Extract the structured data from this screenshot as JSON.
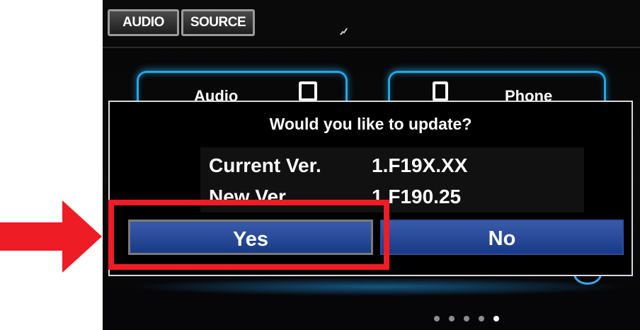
{
  "header": {
    "tabs": [
      {
        "label": "AUDIO"
      },
      {
        "label": "SOURCE"
      }
    ]
  },
  "menu": {
    "tiles": [
      {
        "label": "Audio",
        "icon": "audio-device-icon"
      },
      {
        "label": "Phone",
        "icon": "phone-icon"
      }
    ]
  },
  "dialog": {
    "title": "Would you like to update?",
    "current_label": "Current Ver.",
    "current_value": "1.F19X.XX",
    "new_label": "New Ver.",
    "new_value": "1.F190.25",
    "yes_label": "Yes",
    "no_label": "No"
  },
  "pager": {
    "pages": 5,
    "active_index": 4
  },
  "colors": {
    "highlight": "#ee1c25",
    "button_blue": "#183a86",
    "accent_glow": "#1fa9e6"
  }
}
